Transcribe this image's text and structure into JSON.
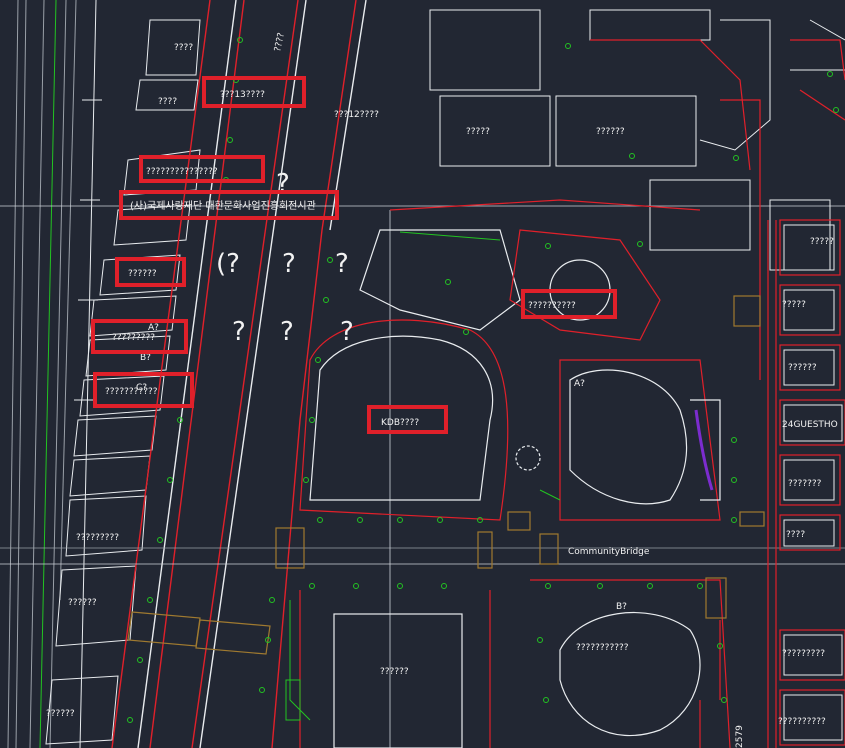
{
  "colors": {
    "background": "#222733",
    "building_outline": "#e9ecef",
    "boundary": "#e0202a",
    "vegetation": "#22c322",
    "parking": "#a07a30",
    "highlight": "#e0202a",
    "waterway": "#7c2ccf"
  },
  "marked_labels": [
    {
      "id": "m1",
      "text": "???13????"
    },
    {
      "id": "m2",
      "text": "???????????????"
    },
    {
      "id": "m3",
      "text": "(사)국제사랑재단 대한문화사업진흥회전시관"
    },
    {
      "id": "m4",
      "text": "??????"
    },
    {
      "id": "m5",
      "text": "?????????"
    },
    {
      "id": "m6",
      "text": "???????????"
    },
    {
      "id": "m7",
      "text": "??????????"
    },
    {
      "id": "m8",
      "text": "KDB????"
    }
  ],
  "map_labels": {
    "l_top1": "????",
    "l_top2": "????",
    "l_road": "????",
    "l_12": "???12????",
    "l_b1": "?????",
    "l_b2": "??????",
    "l_a_left": "A?",
    "l_b_left": "B?",
    "l_c_left": "C?",
    "l_a_right": "A?",
    "l_b_right": "B?",
    "l_bridge": "CommunityBridge",
    "l_r1": "?????",
    "l_r2": "?????",
    "l_r3": "??????",
    "l_guest": "24GUESTHO",
    "l_r4": "???????",
    "l_r5": "????",
    "l_r6": "?????????",
    "l_r7": "??????????",
    "l_left1": "?????????",
    "l_left2": "??????",
    "l_left3": "??????",
    "l_center": "??????",
    "l_bottom": "???????????",
    "l_num": "2579",
    "q1": "?",
    "q2": "?",
    "q3": "?",
    "q4": "?",
    "q5": "(?",
    "q6": "?",
    "q7": "?"
  }
}
